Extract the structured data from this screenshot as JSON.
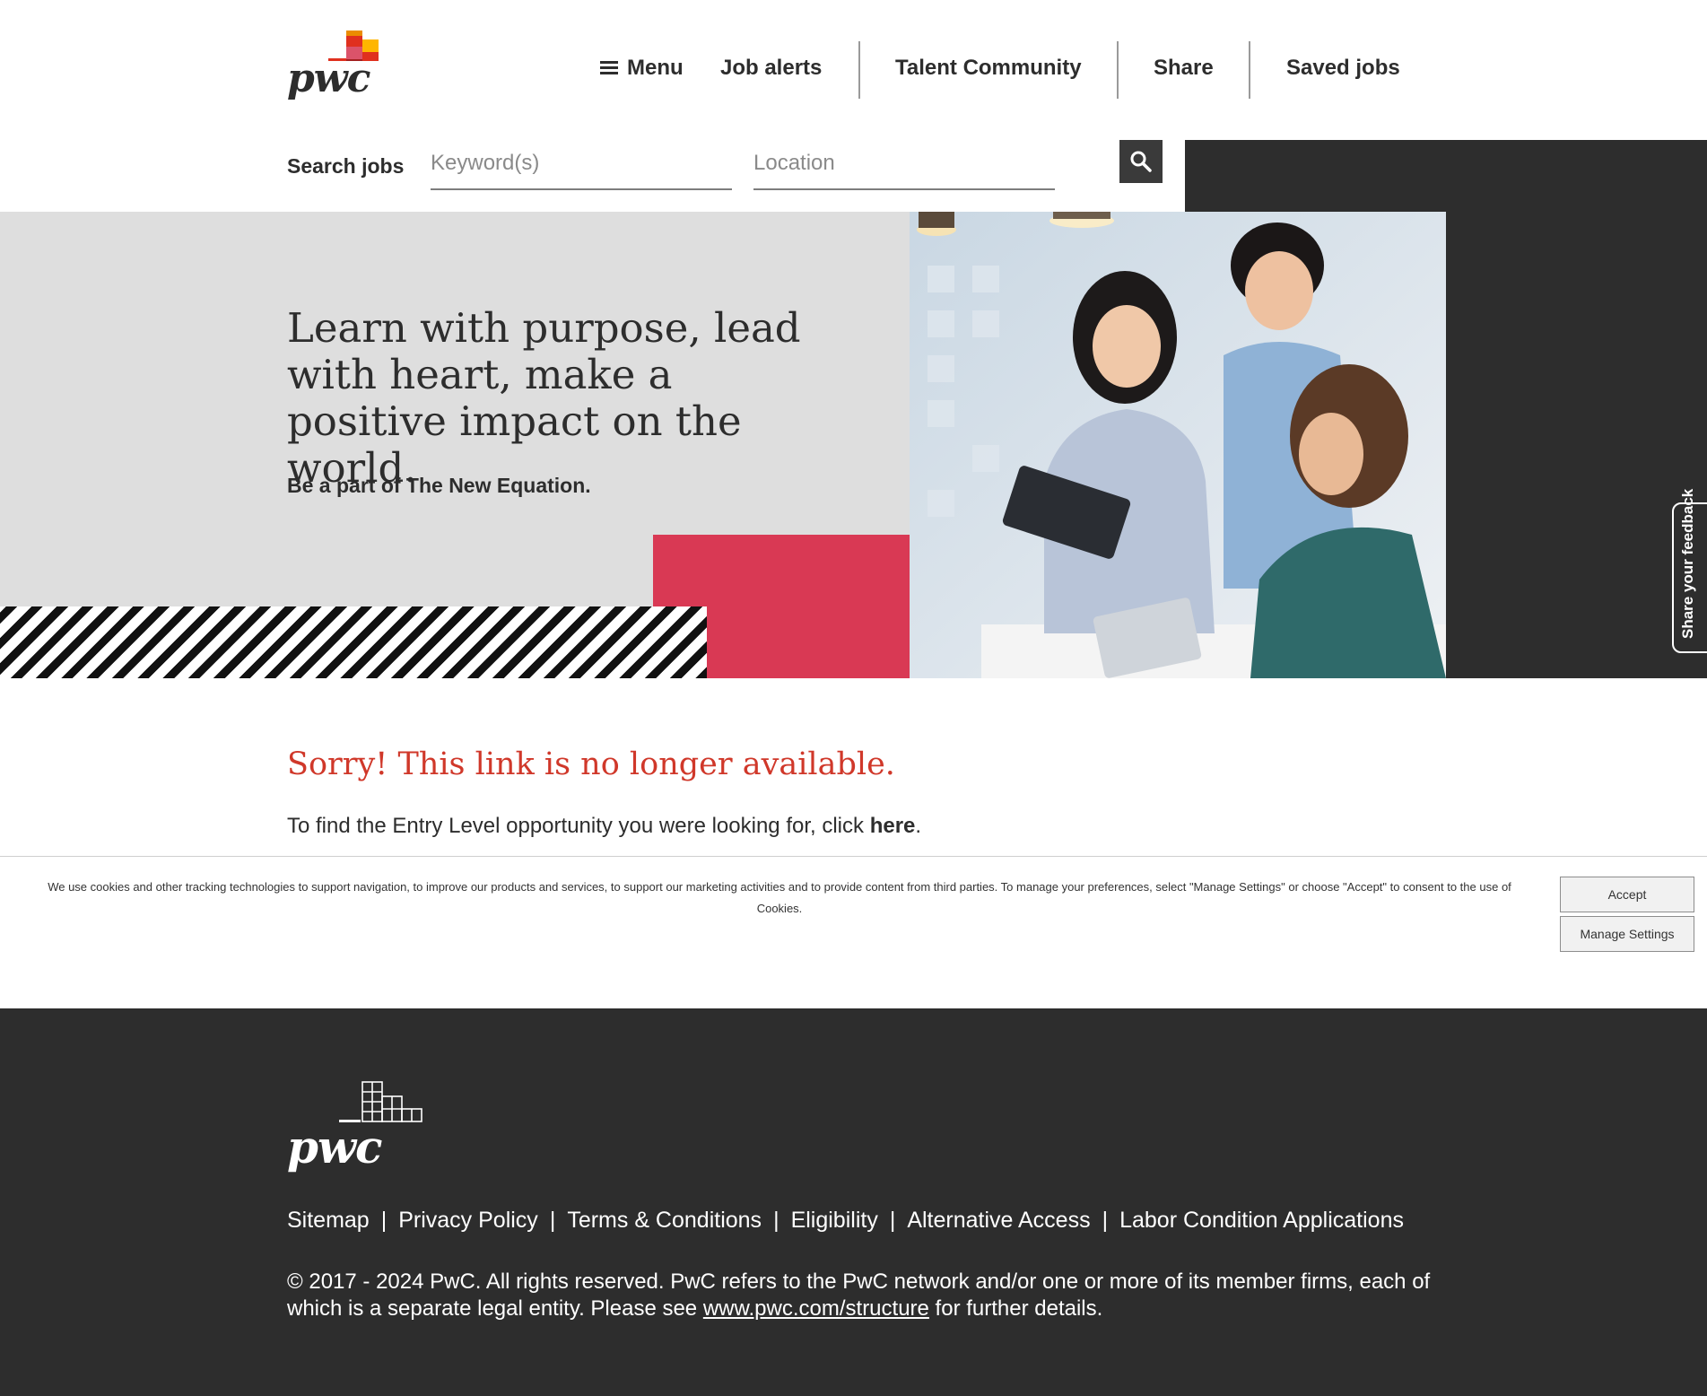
{
  "brand": {
    "logo_text": "pwc",
    "accent": "#d93954",
    "error_color": "#d0382a",
    "dark": "#2d2d2d"
  },
  "header": {
    "menu_label": "Menu",
    "job_alerts": "Job alerts",
    "talent_community": "Talent Community",
    "share": "Share",
    "saved_jobs": "Saved jobs"
  },
  "search": {
    "label": "Search jobs",
    "keyword_placeholder": "Keyword(s)",
    "keyword_value": "",
    "location_placeholder": "Location",
    "location_value": "",
    "button_icon": "search-icon"
  },
  "hero": {
    "title": "Learn with purpose, lead with heart, make a positive impact on the world.",
    "subtitle": "Be a part of The New Equation."
  },
  "feedback": {
    "label": "Share your feedback"
  },
  "message": {
    "heading": "Sorry! This link is no longer available.",
    "body_prefix": "To find the Entry Level opportunity you were looking for, click ",
    "link_text": "here",
    "body_suffix": "."
  },
  "cookie": {
    "text": "We use cookies and other tracking technologies to support navigation, to improve our products and services, to support our marketing activities and to provide content from third parties. To manage your preferences, select \"Manage Settings\" or choose \"Accept\" to consent to the use of Cookies.",
    "accept": "Accept",
    "manage": "Manage Settings"
  },
  "footer": {
    "logo_text": "pwc",
    "links": [
      "Sitemap",
      "Privacy Policy",
      "Terms & Conditions",
      "Eligibility",
      "Alternative Access",
      "Labor Condition Applications"
    ],
    "separator": "|",
    "copyright_prefix": "© 2017 - 2024 PwC. All rights reserved. PwC refers to the PwC network and/or one or more of its member firms, each of which is a separate legal entity. Please see ",
    "copyright_link": "www.pwc.com/structure",
    "copyright_suffix": " for further details."
  }
}
